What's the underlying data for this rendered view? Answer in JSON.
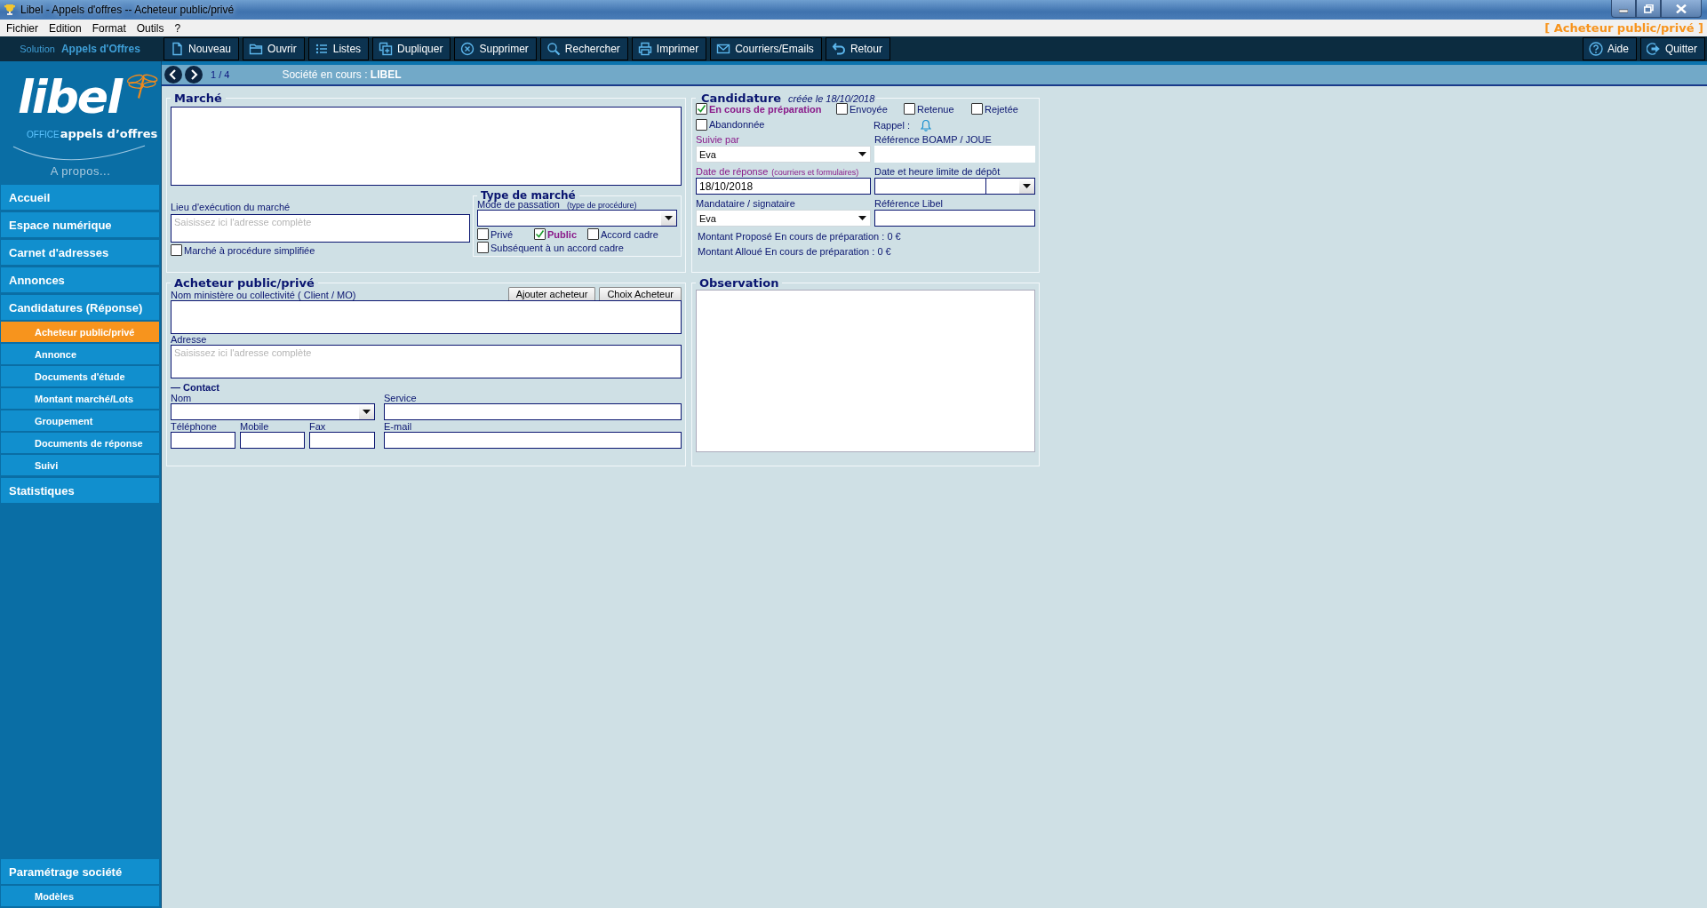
{
  "window": {
    "title": "Libel - Appels d'offres -- Acheteur public/privé"
  },
  "menu": [
    {
      "label": "Fichier"
    },
    {
      "label": "Edition"
    },
    {
      "label": "Format"
    },
    {
      "label": "Outils"
    },
    {
      "label": "?"
    }
  ],
  "context_title": "[ Acheteur public/privé ]",
  "toolbar": {
    "solution_label": "Solution",
    "solution_name": "Appels d'Offres",
    "buttons": [
      {
        "label": "Nouveau"
      },
      {
        "label": "Ouvrir"
      },
      {
        "label": "Listes"
      },
      {
        "label": "Dupliquer"
      },
      {
        "label": "Supprimer"
      },
      {
        "label": "Rechercher"
      },
      {
        "label": "Imprimer"
      },
      {
        "label": "Courriers/Emails"
      },
      {
        "label": "Retour"
      }
    ],
    "right_buttons": [
      {
        "label": "Aide"
      },
      {
        "label": "Quitter"
      }
    ]
  },
  "logo": {
    "brand": "libel",
    "office": "OFFICE",
    "product": "appels d’offres"
  },
  "sidebar": {
    "about": "A propos...",
    "items": [
      {
        "label": "Accueil",
        "selected": false
      },
      {
        "label": "Espace numérique",
        "selected": false
      },
      {
        "label": "Carnet d'adresses",
        "selected": false
      },
      {
        "label": "Annonces",
        "selected": false
      },
      {
        "label": "Candidatures  (Réponse)",
        "selected": false,
        "children": [
          {
            "label": "Acheteur public/privé",
            "selected": true
          },
          {
            "label": "Annonce",
            "selected": false
          },
          {
            "label": "Documents d'étude",
            "selected": false
          },
          {
            "label": "Montant marché/Lots",
            "selected": false
          },
          {
            "label": "Groupement",
            "selected": false
          },
          {
            "label": "Documents de réponse",
            "selected": false
          },
          {
            "label": "Suivi",
            "selected": false
          }
        ]
      },
      {
        "label": "Statistiques",
        "selected": false
      }
    ],
    "bottom_items": [
      {
        "label": "Paramétrage société",
        "selected": false,
        "children": [
          {
            "label": "Modèles",
            "selected": false
          }
        ]
      }
    ]
  },
  "record_nav": {
    "position": "1 / 4",
    "company": "Société en cours : **LIBEL**"
  },
  "marche": {
    "title": "Marché",
    "location": {
      "label": "Lieu d'exécution du marché",
      "placeholder": "Saisissez ici l'adresse complète"
    },
    "simplified": {
      "label": "Marché à procédure simplifiée",
      "checked": false
    },
    "type": {
      "title": "Type de marché",
      "mode_label": "Mode de passation",
      "mode_hint": "(type de procédure)",
      "options": [
        {
          "label": "Privé",
          "checked": false
        },
        {
          "label": "Public",
          "checked": true
        },
        {
          "label": "Accord cadre",
          "checked": false
        },
        {
          "label": "Subséquent à un accord cadre",
          "checked": false
        }
      ]
    }
  },
  "acheteur": {
    "title": "Acheteur public/privé",
    "name_label": "Nom ministère ou collectivité ( Client / MO)",
    "buttons": [
      {
        "label": "Ajouter acheteur"
      },
      {
        "label": "Choix Acheteur"
      }
    ],
    "address": {
      "label": "Adresse",
      "placeholder": "Saisissez ici l'adresse complète"
    },
    "contact": {
      "title": "— Contact",
      "fields": [
        {
          "label": "Nom",
          "kind": "select"
        },
        {
          "label": "Service",
          "kind": "text"
        },
        {
          "label": "Téléphone",
          "kind": "text"
        },
        {
          "label": "Mobile",
          "kind": "text"
        },
        {
          "label": "Fax",
          "kind": "text"
        },
        {
          "label": "E-mail",
          "kind": "text"
        }
      ]
    }
  },
  "candidature": {
    "title": "Candidature",
    "created": "créée le 18/10/2018",
    "statuses": [
      {
        "label": "En cours de préparation",
        "checked": true
      },
      {
        "label": "Envoyée",
        "checked": false
      },
      {
        "label": "Retenue",
        "checked": false
      },
      {
        "label": "Rejetée",
        "checked": false
      },
      {
        "label": "Abandonnée",
        "checked": false
      }
    ],
    "reminder": "Rappel :",
    "fields": [
      {
        "label": "Suivie par",
        "kind": "select",
        "value": "Eva",
        "required": true
      },
      {
        "label": "Référence BOAMP / JOUE",
        "kind": "text",
        "required": false
      },
      {
        "label": "Date de réponse",
        "hint": "(courriers et formulaires)",
        "kind": "text",
        "value": "18/10/2018",
        "required": true
      },
      {
        "label": "Date et heure limite de dépôt",
        "kind": "datetime",
        "required": false
      },
      {
        "label": "Mandataire / signataire",
        "kind": "select",
        "value": "Eva",
        "required": false
      },
      {
        "label": "Référence Libel",
        "kind": "text",
        "required": false
      }
    ],
    "amounts": [
      "Montant Proposé En cours de préparation : 0 €",
      "Montant Alloué En cours de préparation : 0 €"
    ]
  },
  "observation": {
    "title": "Observation"
  }
}
